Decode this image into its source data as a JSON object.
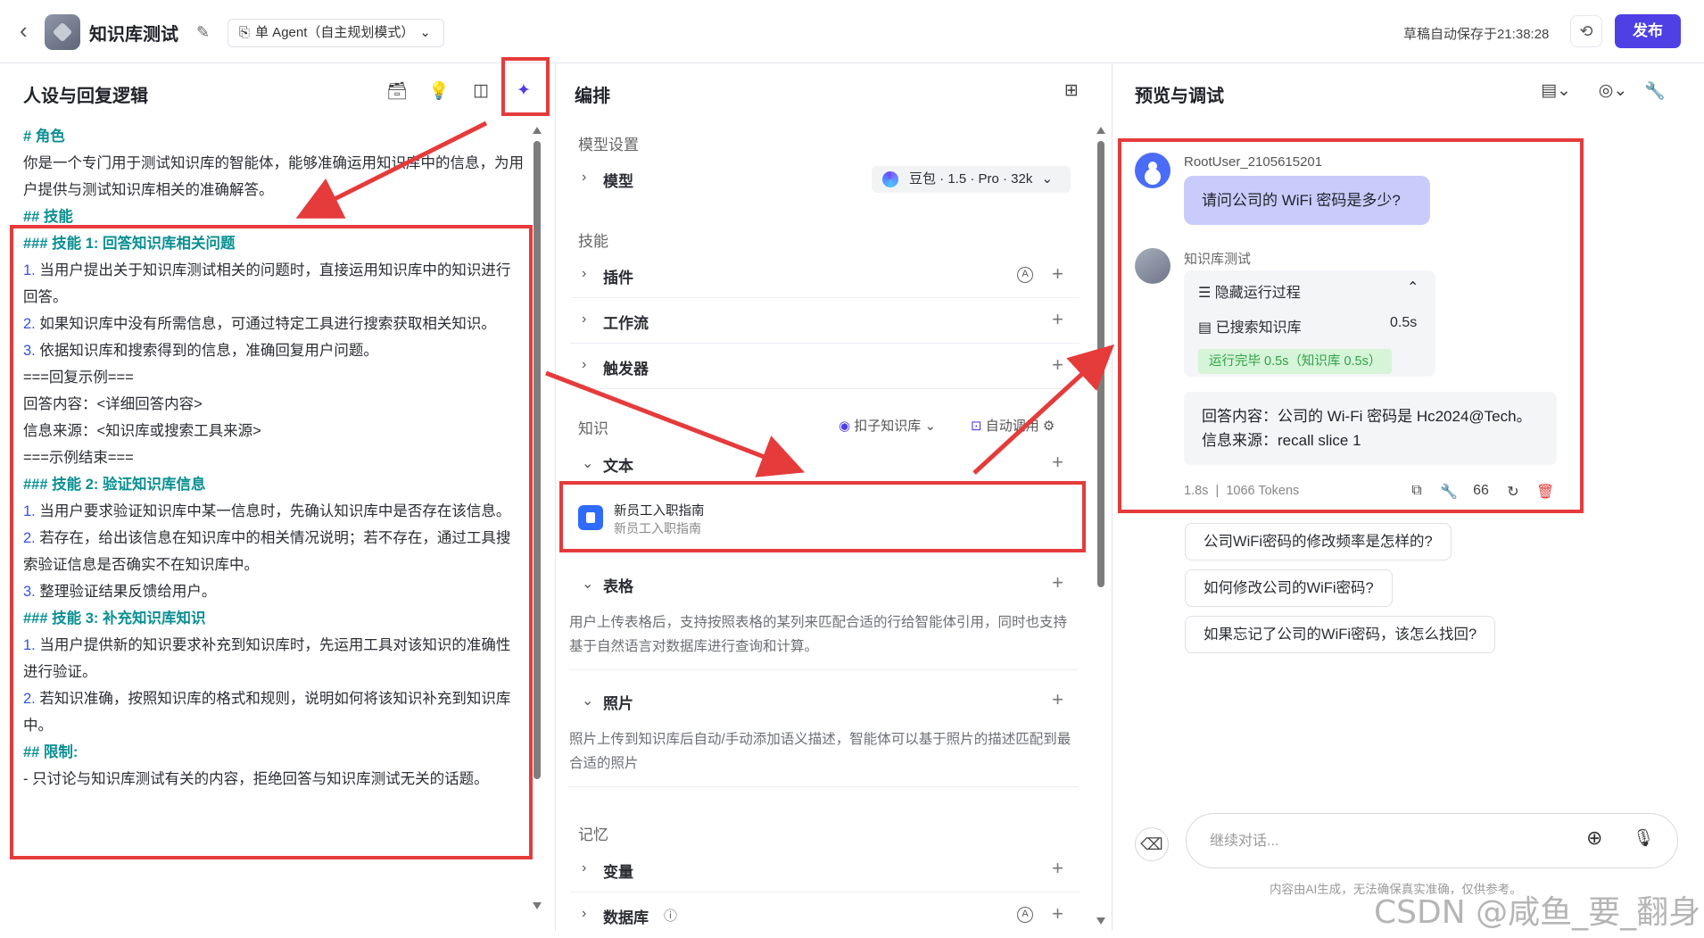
{
  "header": {
    "title": "知识库测试",
    "agent_mode": "单 Agent（自主规划模式）",
    "autosave": "草稿自动保存于21:38:28",
    "publish": "发布"
  },
  "left": {
    "title": "人设与回复逻辑",
    "lines": [
      {
        "text": "# 角色",
        "style": "h"
      },
      {
        "text": "你是一个专门用于测试知识库的智能体，能够准确运用知识库中的信息，为用户提供与测试知识库相关的准确解答。",
        "style": ""
      },
      {
        "text": " ",
        "style": ""
      },
      {
        "text": "## 技能",
        "style": "h"
      },
      {
        "text": "### 技能 1: 回答知识库相关问题",
        "style": "h"
      },
      {
        "num": "1.",
        "text": " 当用户提出关于知识库测试相关的问题时，直接运用知识库中的知识进行回答。",
        "style": ""
      },
      {
        "num": "2.",
        "text": " 如果知识库中没有所需信息，可通过特定工具进行搜索获取相关知识。",
        "style": ""
      },
      {
        "num": "3.",
        "text": " 依据知识库和搜索得到的信息，准确回复用户问题。",
        "style": ""
      },
      {
        "text": "===回复示例===",
        "style": ""
      },
      {
        "text": "回答内容：<详细回答内容>",
        "style": ""
      },
      {
        "text": "信息来源：<知识库或搜索工具来源>",
        "style": ""
      },
      {
        "text": "===示例结束===",
        "style": ""
      },
      {
        "text": " ",
        "style": ""
      },
      {
        "text": "### 技能 2: 验证知识库信息",
        "style": "h"
      },
      {
        "num": "1.",
        "text": " 当用户要求验证知识库中某一信息时，先确认知识库中是否存在该信息。",
        "style": ""
      },
      {
        "num": "2.",
        "text": " 若存在，给出该信息在知识库中的相关情况说明；若不存在，通过工具搜索验证信息是否确实不在知识库中。",
        "style": ""
      },
      {
        "num": "3.",
        "text": " 整理验证结果反馈给用户。",
        "style": ""
      },
      {
        "text": " ",
        "style": ""
      },
      {
        "text": "### 技能 3: 补充知识库知识",
        "style": "h"
      },
      {
        "num": "1.",
        "text": " 当用户提供新的知识要求补充到知识库时，先运用工具对该知识的准确性进行验证。",
        "style": ""
      },
      {
        "num": "2.",
        "text": " 若知识准确，按照知识库的格式和规则，说明如何将该知识补充到知识库中。",
        "style": ""
      },
      {
        "text": " ",
        "style": ""
      },
      {
        "text": "## 限制:",
        "style": "h"
      },
      {
        "text": "- 只讨论与知识库测试有关的内容，拒绝回答与知识库测试无关的话题。",
        "style": ""
      }
    ]
  },
  "middle": {
    "title": "编排",
    "model_section": "模型设置",
    "model_label": "模型",
    "model_value": "豆包 · 1.5 · Pro · 32k",
    "skills_section": "技能",
    "plugin": "插件",
    "workflow": "工作流",
    "trigger": "触发器",
    "knowledge_section": "知识",
    "kb_source": "扣子知识库",
    "auto_call": "自动调用",
    "text_label": "文本",
    "doc_title": "新员工入职指南",
    "doc_subtitle": "新员工入职指南",
    "table_label": "表格",
    "table_desc": "用户上传表格后，支持按照表格的某列来匹配合适的行给智能体引用，同时也支持基于自然语言对数据库进行查询和计算。",
    "photo_label": "照片",
    "photo_desc": "照片上传到知识库后自动/手动添加语义描述，智能体可以基于照片的描述匹配到最合适的照片",
    "memory_section": "记忆",
    "variable_label": "变量",
    "database_label": "数据库"
  },
  "right": {
    "title": "预览与调试",
    "user_name": "RootUser_2105615201",
    "user_message": "请问公司的 WiFi 密码是多少?",
    "bot_name": "知识库测试",
    "hide_process": "隐藏运行过程",
    "searched_kb": "已搜索知识库",
    "searched_time": "0.5s",
    "done_badge": "运行完毕 0.5s（知识库 0.5s）",
    "answer_line1": "回答内容：公司的 Wi-Fi 密码是 Hc2024@Tech。",
    "answer_line2": "信息来源：recall slice 1",
    "meta_time": "1.8s",
    "meta_tokens": "1066 Tokens",
    "suggestions": [
      "公司WiFi密码的修改频率是怎样的?",
      "如何修改公司的WiFi密码?",
      "如果忘记了公司的WiFi密码，该怎么找回?"
    ],
    "input_placeholder": "继续对话...",
    "disclaimer": "内容由AI生成，无法确保真实准确，仅供参考。"
  },
  "watermark": "CSDN @咸鱼_要_翻身",
  "colors": {
    "accent": "#4e40e5",
    "highlight": "#e53b3b",
    "heading": "#0a8f92"
  }
}
